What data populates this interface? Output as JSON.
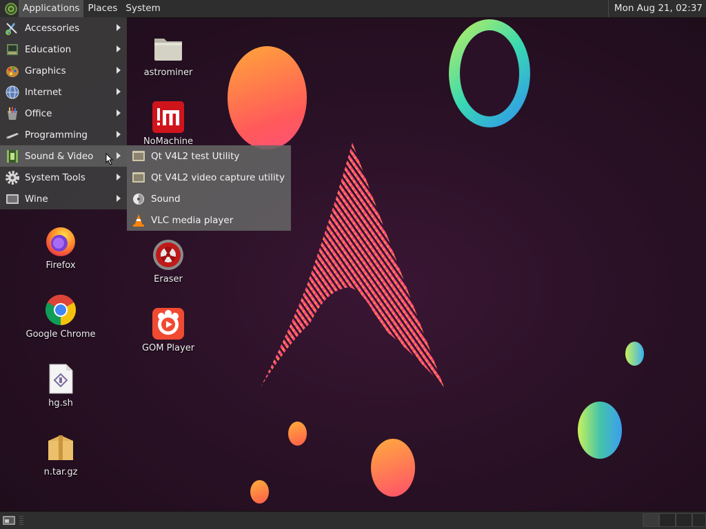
{
  "top_panel": {
    "menus": [
      "Applications",
      "Places",
      "System"
    ],
    "clock": "Mon Aug 21, 02:37"
  },
  "app_menu": {
    "items": [
      {
        "label": "Accessories",
        "icon": "accessories-icon"
      },
      {
        "label": "Education",
        "icon": "education-icon"
      },
      {
        "label": "Graphics",
        "icon": "graphics-icon"
      },
      {
        "label": "Internet",
        "icon": "internet-globe-icon"
      },
      {
        "label": "Office",
        "icon": "office-icon"
      },
      {
        "label": "Programming",
        "icon": "programming-icon"
      },
      {
        "label": "Sound & Video",
        "icon": "multimedia-icon"
      },
      {
        "label": "System Tools",
        "icon": "gear-icon"
      },
      {
        "label": "Wine",
        "icon": "wine-icon"
      }
    ],
    "active_index": 6
  },
  "sub_menu": {
    "items": [
      {
        "label": "Qt V4L2 test Utility",
        "icon": "window-icon"
      },
      {
        "label": "Qt V4L2 video capture utility",
        "icon": "window-icon"
      },
      {
        "label": "Sound",
        "icon": "sound-icon"
      },
      {
        "label": "VLC media player",
        "icon": "vlc-cone-icon"
      }
    ]
  },
  "desktop_icons": [
    {
      "label": "astrominer",
      "icon": "folder-icon"
    },
    {
      "label": "NoMachine",
      "icon": "nomachine-icon"
    },
    {
      "label": "Firefox",
      "icon": "firefox-icon"
    },
    {
      "label": "Eraser",
      "icon": "eraser-icon"
    },
    {
      "label": "Google Chrome",
      "icon": "chrome-icon"
    },
    {
      "label": "GOM Player",
      "icon": "gom-player-icon"
    },
    {
      "label": "hg.sh",
      "icon": "script-file-icon"
    },
    {
      "label": "n.tar.gz",
      "icon": "archive-icon"
    }
  ],
  "colors": {
    "panel": "#2e2e2e",
    "menu_bg": "#3e3e3e",
    "menu_active": "#5f5f5f",
    "wallpaper": "#2a1126"
  }
}
